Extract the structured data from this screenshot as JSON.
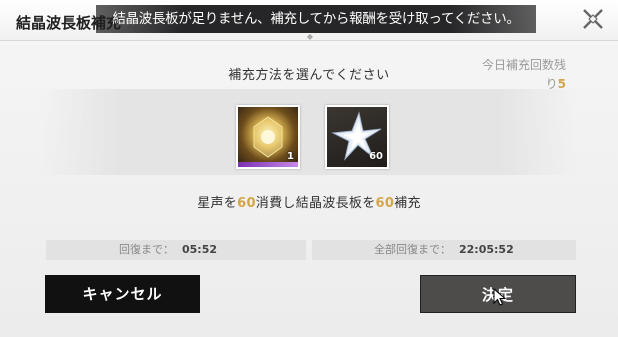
{
  "header": {
    "title": "結晶波長板補充",
    "close_icon": "close-x-icon"
  },
  "toast": {
    "message": "結晶波長板が足りません、補充してから報酬を受け取ってください。"
  },
  "panel": {
    "subtitle": "補充方法を選んでください",
    "remaining_label": "今日補充回数残",
    "remaining_suffix": "り",
    "remaining_count": "5"
  },
  "items": [
    {
      "name": "crystal-item",
      "icon": "gold-crystal-icon",
      "quantity": "1",
      "rarity_color": "#a44fd6"
    },
    {
      "name": "stellar-jade-item",
      "icon": "silver-star-icon",
      "quantity": "60"
    }
  ],
  "description": {
    "prefix": "星声を",
    "cost": "60",
    "middle": "消費し結晶波長板を",
    "amount": "60",
    "suffix": "補充"
  },
  "timers": {
    "recover_label": "回復まで：",
    "recover_value": "05:52",
    "full_label": "全部回復まで：",
    "full_value": "22:05:52"
  },
  "buttons": {
    "cancel_label": "キャンセル",
    "confirm_label": "決定"
  },
  "colors": {
    "highlight": "#d4a64a",
    "dark_button": "#111111"
  }
}
